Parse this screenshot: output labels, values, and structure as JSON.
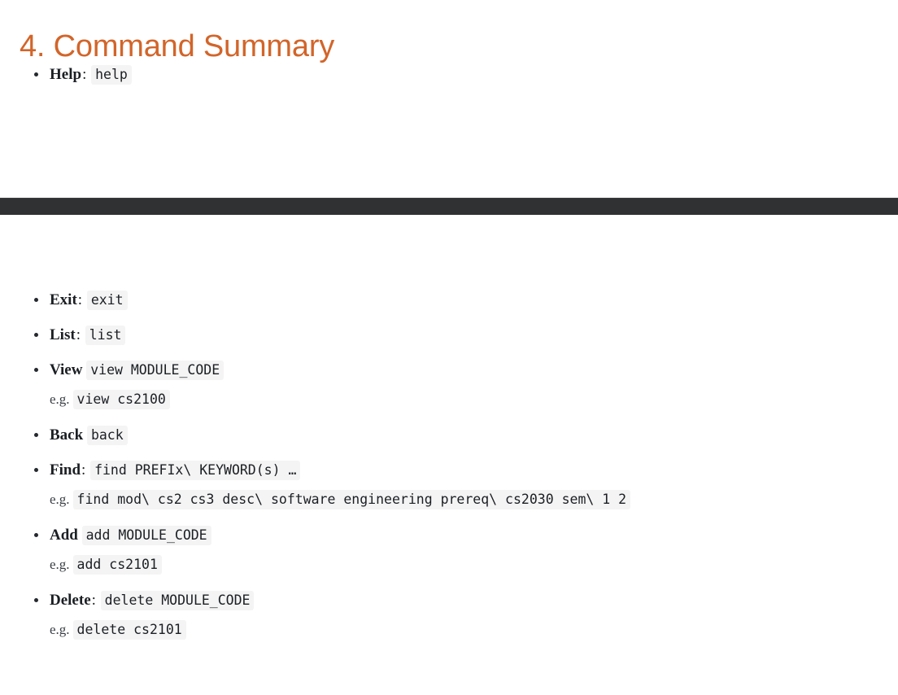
{
  "heading": "4. Command Summary",
  "colors": {
    "heading": "#d2652a",
    "band": "#2f3133",
    "code_background": "#f4f4f4",
    "text": "#1b1f23"
  },
  "band": {
    "present": true
  },
  "top_list": [
    {
      "label": "Help",
      "separator": ":",
      "code": "help",
      "example_prefix": "",
      "example_code": ""
    }
  ],
  "main_list": [
    {
      "label": "Exit",
      "separator": ":",
      "code": "exit",
      "example_prefix": "",
      "example_code": ""
    },
    {
      "label": "List",
      "separator": ":",
      "code": "list",
      "example_prefix": "",
      "example_code": ""
    },
    {
      "label": "View",
      "separator": "",
      "code": "view MODULE_CODE",
      "example_prefix": "e.g.",
      "example_code": "view cs2100"
    },
    {
      "label": "Back",
      "separator": "",
      "code": "back",
      "example_prefix": "",
      "example_code": ""
    },
    {
      "label": "Find",
      "separator": ":",
      "code": "find PREFIx\\ KEYWORD(s) …",
      "example_prefix": "e.g.",
      "example_code": "find mod\\ cs2 cs3 desc\\ software engineering prereq\\ cs2030 sem\\ 1 2"
    },
    {
      "label": "Add",
      "separator": "",
      "code": "add MODULE_CODE",
      "example_prefix": "e.g.",
      "example_code": "add cs2101"
    },
    {
      "label": "Delete",
      "separator": ":",
      "code": "delete MODULE_CODE",
      "example_prefix": "e.g.",
      "example_code": "delete cs2101"
    }
  ]
}
